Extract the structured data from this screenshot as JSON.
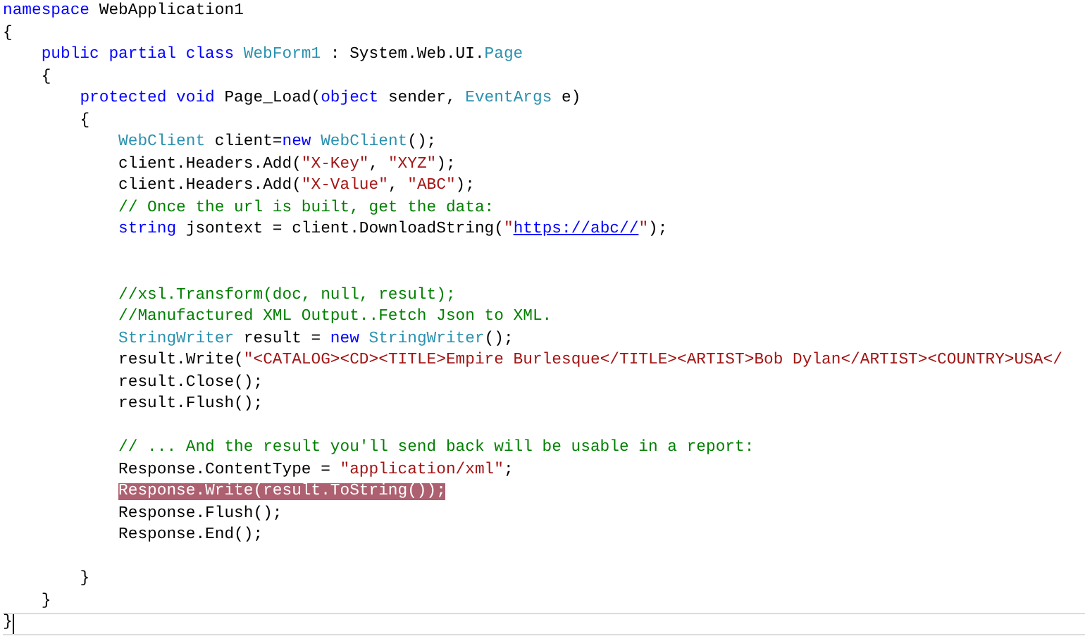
{
  "editor": {
    "lines": [
      {
        "kind": "code",
        "tokens": [
          {
            "kind": "keyword",
            "text": "namespace"
          },
          {
            "kind": "plain",
            "text": " WebApplication1"
          }
        ]
      },
      {
        "kind": "code",
        "tokens": [
          {
            "kind": "plain",
            "text": "{"
          }
        ]
      },
      {
        "kind": "code",
        "tokens": [
          {
            "kind": "keyword",
            "text": "    public partial class "
          },
          {
            "kind": "type",
            "text": "WebForm1"
          },
          {
            "kind": "plain",
            "text": " : System.Web.UI."
          },
          {
            "kind": "type",
            "text": "Page"
          }
        ]
      },
      {
        "kind": "code",
        "tokens": [
          {
            "kind": "plain",
            "text": "    {"
          }
        ]
      },
      {
        "kind": "code",
        "tokens": [
          {
            "kind": "keyword",
            "text": "        protected void"
          },
          {
            "kind": "plain",
            "text": " Page_Load("
          },
          {
            "kind": "keyword",
            "text": "object"
          },
          {
            "kind": "plain",
            "text": " sender, "
          },
          {
            "kind": "type",
            "text": "EventArgs"
          },
          {
            "kind": "plain",
            "text": " e)"
          }
        ]
      },
      {
        "kind": "code",
        "tokens": [
          {
            "kind": "plain",
            "text": "        {"
          }
        ]
      },
      {
        "kind": "code",
        "tokens": [
          {
            "kind": "type",
            "text": "            WebClient"
          },
          {
            "kind": "plain",
            "text": " client="
          },
          {
            "kind": "keyword",
            "text": "new "
          },
          {
            "kind": "type",
            "text": "WebClient"
          },
          {
            "kind": "plain",
            "text": "();"
          }
        ]
      },
      {
        "kind": "code",
        "tokens": [
          {
            "kind": "plain",
            "text": "            client.Headers.Add("
          },
          {
            "kind": "string",
            "text": "\"X-Key\""
          },
          {
            "kind": "plain",
            "text": ", "
          },
          {
            "kind": "string",
            "text": "\"XYZ\""
          },
          {
            "kind": "plain",
            "text": ");"
          }
        ]
      },
      {
        "kind": "code",
        "tokens": [
          {
            "kind": "plain",
            "text": "            client.Headers.Add("
          },
          {
            "kind": "string",
            "text": "\"X-Value\""
          },
          {
            "kind": "plain",
            "text": ", "
          },
          {
            "kind": "string",
            "text": "\"ABC\""
          },
          {
            "kind": "plain",
            "text": ");"
          }
        ]
      },
      {
        "kind": "code",
        "tokens": [
          {
            "kind": "comment",
            "text": "            // Once the url is built, get the data:"
          }
        ]
      },
      {
        "kind": "code",
        "tokens": [
          {
            "kind": "keyword",
            "text": "            string"
          },
          {
            "kind": "plain",
            "text": " jsontext = client.DownloadString("
          },
          {
            "kind": "string",
            "text": "\""
          },
          {
            "kind": "link",
            "text": "https://abc//"
          },
          {
            "kind": "string",
            "text": "\""
          },
          {
            "kind": "plain",
            "text": ");"
          }
        ]
      },
      {
        "kind": "blank"
      },
      {
        "kind": "blank"
      },
      {
        "kind": "code",
        "tokens": [
          {
            "kind": "comment",
            "text": "            //xsl.Transform(doc, null, result);"
          }
        ]
      },
      {
        "kind": "code",
        "tokens": [
          {
            "kind": "comment",
            "text": "            //Manufactured XML Output..Fetch Json to XML."
          }
        ]
      },
      {
        "kind": "code",
        "tokens": [
          {
            "kind": "type",
            "text": "            StringWriter"
          },
          {
            "kind": "plain",
            "text": " result = "
          },
          {
            "kind": "keyword",
            "text": "new "
          },
          {
            "kind": "type",
            "text": "StringWriter"
          },
          {
            "kind": "plain",
            "text": "();"
          }
        ]
      },
      {
        "kind": "code",
        "tokens": [
          {
            "kind": "plain",
            "text": "            result.Write("
          },
          {
            "kind": "string",
            "text": "\"<CATALOG><CD><TITLE>Empire Burlesque</TITLE><ARTIST>Bob Dylan</ARTIST><COUNTRY>USA</"
          }
        ]
      },
      {
        "kind": "code",
        "tokens": [
          {
            "kind": "plain",
            "text": "            result.Close();"
          }
        ]
      },
      {
        "kind": "code",
        "tokens": [
          {
            "kind": "plain",
            "text": "            result.Flush();"
          }
        ]
      },
      {
        "kind": "blank"
      },
      {
        "kind": "code",
        "tokens": [
          {
            "kind": "comment",
            "text": "            // ... And the result you'll send back will be usable in a report:"
          }
        ]
      },
      {
        "kind": "code",
        "tokens": [
          {
            "kind": "plain",
            "text": "            Response.ContentType = "
          },
          {
            "kind": "string",
            "text": "\"application/xml\""
          },
          {
            "kind": "plain",
            "text": ";"
          }
        ]
      },
      {
        "kind": "code",
        "tokens": [
          {
            "kind": "selection",
            "text": "            Response.Write(result.ToString());"
          }
        ]
      },
      {
        "kind": "code",
        "tokens": [
          {
            "kind": "plain",
            "text": "            Response.Flush();"
          }
        ]
      },
      {
        "kind": "code",
        "tokens": [
          {
            "kind": "plain",
            "text": "            Response.End();"
          }
        ]
      },
      {
        "kind": "blank"
      },
      {
        "kind": "code",
        "tokens": [
          {
            "kind": "plain",
            "text": "        }"
          }
        ]
      },
      {
        "kind": "code",
        "tokens": [
          {
            "kind": "plain",
            "text": "    }"
          }
        ]
      },
      {
        "kind": "current",
        "tokens": [
          {
            "kind": "plain",
            "text": "}"
          }
        ]
      }
    ]
  }
}
